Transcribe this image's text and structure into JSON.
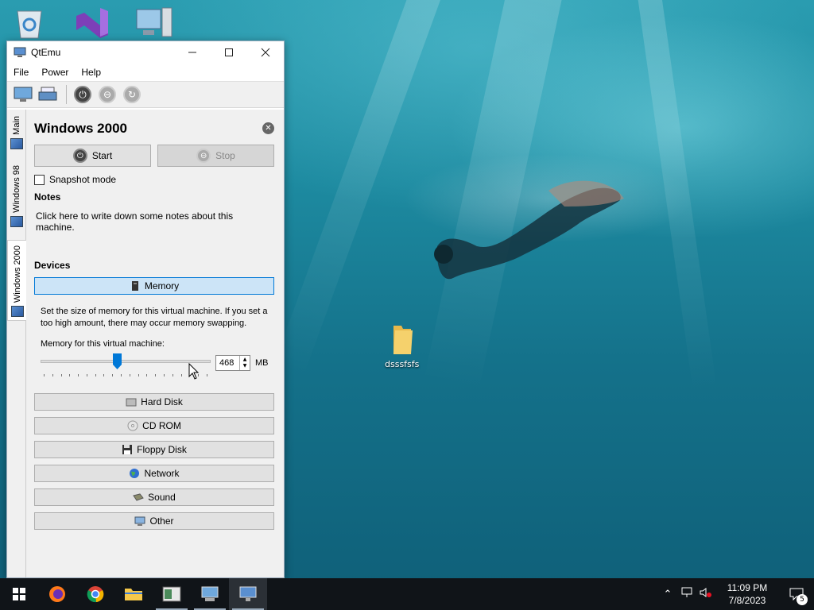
{
  "desktop": {
    "folder_label": "dsssfsfs"
  },
  "window": {
    "title": "QtEmu",
    "menu": [
      "File",
      "Power",
      "Help"
    ],
    "tabs": [
      "Main",
      "Windows 98",
      "Windows 2000"
    ],
    "active_tab": "Windows 2000"
  },
  "vm": {
    "name": "Windows 2000",
    "start_label": "Start",
    "stop_label": "Stop",
    "snapshot_label": "Snapshot mode",
    "notes_heading": "Notes",
    "notes_text": "Click here to write down some notes about this machine.",
    "devices_heading": "Devices"
  },
  "devices": {
    "memory": "Memory",
    "memory_description": "Set the size of memory for this virtual machine. If you set a too high amount, there may occur memory swapping.",
    "memory_label": "Memory for this virtual machine:",
    "memory_value": "468",
    "memory_unit": "MB",
    "memory_fraction": 0.45,
    "hard_disk": "Hard Disk",
    "cd_rom": "CD ROM",
    "floppy_disk": "Floppy Disk",
    "network": "Network",
    "sound": "Sound",
    "other": "Other"
  },
  "taskbar": {
    "time": "11:09 PM",
    "date": "7/8/2023",
    "notification_count": "5"
  },
  "colors": {
    "accent": "#0078d7",
    "active_device": "#cce4f7"
  }
}
